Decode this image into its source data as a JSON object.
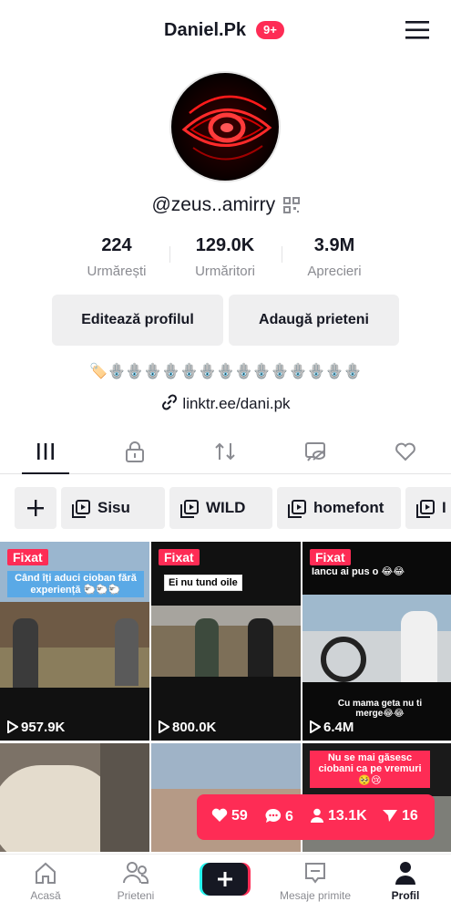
{
  "header": {
    "username": "Daniel.Pk",
    "badge": "9+"
  },
  "profile": {
    "handle": "@zeus..amirry",
    "stats": [
      {
        "value": "224",
        "label": "Urmărești"
      },
      {
        "value": "129.0K",
        "label": "Urmăritori"
      },
      {
        "value": "3.9M",
        "label": "Aprecieri"
      }
    ],
    "buttons": {
      "edit": "Editează profilul",
      "add_friends": "Adaugă prieteni"
    },
    "bio": "🏷️🪬🪬🪬🪬🪬🪬🪬🪬🪬🪬🪬🪬🪬🪬",
    "link": "linktr.ee/dani.pk"
  },
  "tabs": [
    "videos-grid-icon",
    "lock-icon",
    "repost-icon",
    "hidden-likes-icon",
    "heart-icon"
  ],
  "playlists": [
    "Sisu",
    "WILD",
    "homefont",
    "I"
  ],
  "videos": [
    {
      "pinned": "Fixat",
      "caption": "Când îți aduci cioban fără experiență 🐑🐑🐑",
      "views": "957.9K"
    },
    {
      "pinned": "Fixat",
      "caption": "Ei nu tund oile",
      "views": "800.0K"
    },
    {
      "pinned": "Fixat",
      "caption": "Iancu ai pus o 😂😂",
      "caption2": "Cu mama geta nu ti merge😂😂",
      "views": "6.4M"
    },
    {
      "pinned": "",
      "caption": "",
      "views": ""
    },
    {
      "pinned": "",
      "caption": "",
      "views": ""
    },
    {
      "pinned": "",
      "caption": "Nu se mai găsesc ciobani ca pe vremuri 🥺😢",
      "views": ""
    }
  ],
  "live_stats": {
    "likes": "59",
    "comments": "6",
    "viewers": "13.1K",
    "shares": "16"
  },
  "nav": {
    "home": "Acasă",
    "friends": "Prieteni",
    "inbox": "Mesaje primite",
    "profile": "Profil"
  },
  "colors": {
    "accent": "#fe2c55",
    "text": "#161823",
    "muted": "#8a8b91"
  }
}
